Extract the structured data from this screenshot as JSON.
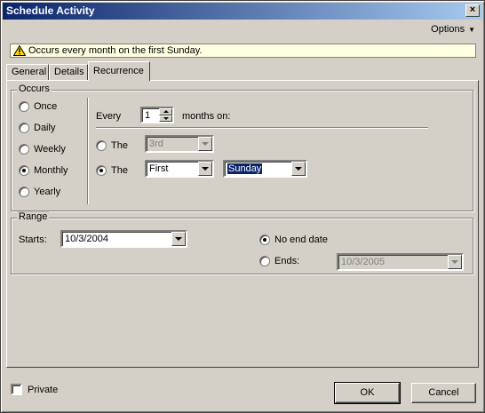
{
  "window": {
    "title": "Schedule Activity",
    "close": "×"
  },
  "options_menu": {
    "label": "Options"
  },
  "info": {
    "text": "Occurs every month on the first Sunday."
  },
  "tabs": [
    {
      "label": "General"
    },
    {
      "label": "Details"
    },
    {
      "label": "Recurrence"
    }
  ],
  "occurs": {
    "title": "Occurs",
    "options": [
      {
        "label": "Once",
        "checked": false
      },
      {
        "label": "Daily",
        "checked": false
      },
      {
        "label": "Weekly",
        "checked": false
      },
      {
        "label": "Monthly",
        "checked": true
      },
      {
        "label": "Yearly",
        "checked": false
      }
    ],
    "every_label": "Every",
    "every_value": "1",
    "months_on_label": "months on:",
    "the_day": {
      "label": "The",
      "value": "3rd",
      "checked": false
    },
    "the_weekday": {
      "label": "The",
      "ordinal": "First",
      "weekday": "Sunday",
      "checked": true
    }
  },
  "range": {
    "title": "Range",
    "starts_label": "Starts:",
    "starts_value": "10/3/2004",
    "no_end_label": "No end date",
    "no_end_checked": true,
    "ends_label": "Ends:",
    "ends_value": "10/3/2005",
    "ends_checked": false
  },
  "footer": {
    "private_label": "Private",
    "ok_label": "OK",
    "cancel_label": "Cancel"
  }
}
